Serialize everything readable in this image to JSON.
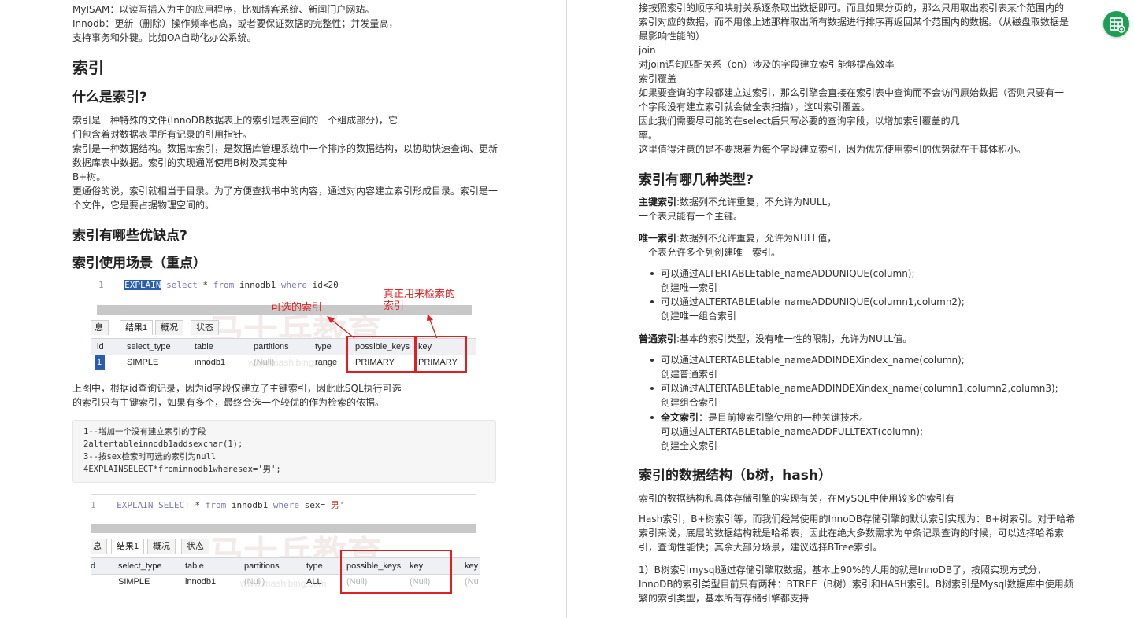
{
  "left": {
    "intro_lines": [
      "MyISAM：以读写插入为主的应用程序，比如博客系统、新闻门户网站。",
      "Innodb：更新（删除）操作频率也高，或者要保证数据的完整性；并发量高，",
      "支持事务和外键。比如OA自动化办公系统。"
    ],
    "h_index": "索引",
    "h_what": "什么是索引?",
    "what_lines": [
      "索引是一种特殊的文件(InnoDB数据表上的索引是表空间的一个组成部分)，它",
      "们包含着对数据表里所有记录的引用指针。",
      "索引是一种数据结构。数据库索引，是数据库管理系统中一个排序的数据结构，以协助快速查询、更新",
      "数据库表中数据。索引的实现通常使用B树及其变种",
      "B+树。",
      "更通俗的说，索引就相当于目录。为了方便查找书中的内容，通过对内容建立索引形成目录。索引是一",
      "个文件，它是要占据物理空间的。"
    ],
    "h_proscons": "索引有哪些优缺点?",
    "h_scenario": "索引使用场景（重点）",
    "fig1": {
      "line_no": "1",
      "kw_explain": "EXPLAIN",
      "rest": [
        " ",
        "select",
        " * ",
        "from",
        " innodb1 ",
        "where",
        " id<20"
      ],
      "note_possible": "可选的索引",
      "note_key_1": "真正用来检索的",
      "note_key_2": "索引",
      "tabs": [
        "息",
        "结果1",
        "概况",
        "状态"
      ],
      "headers": [
        "id",
        "select_type",
        "table",
        "partitions",
        "type",
        "possible_keys",
        "key"
      ],
      "row": [
        "1",
        "SIMPLE",
        "innodb1",
        "(Null)",
        "range",
        "PRIMARY",
        "PRIMARY"
      ],
      "wm_url": "www.mashibing.com"
    },
    "after_fig1_lines": [
      "上图中，根据id查询记录，因为id字段仅建立了主键索引，因此此SQL执行可选",
      "的索引只有主键索引，如果有多个，最终会选一个较优的作为检索的依据。"
    ],
    "code_lines": [
      "1--增加一个没有建立索引的字段",
      "2altertableinnodb1addsexchar(1);",
      "3--按sex检索时可选的索引为null",
      "4EXPLAINSELECT*frominnodb1wheresex='男';"
    ],
    "fig2": {
      "line_no": "1",
      "tokens": [
        "EXPLAIN SELECT",
        " * ",
        "from",
        " innodb1 ",
        "where",
        " sex=",
        "'男'"
      ],
      "tabs": [
        "息",
        "结果1",
        "概况",
        "状态"
      ],
      "headers": [
        "d",
        "select_type",
        "table",
        "partitions",
        "type",
        "possible_keys",
        "key",
        "key"
      ],
      "row": [
        "",
        "SIMPLE",
        "innodb1",
        "(Null)",
        "ALL",
        "(Null)",
        "(Null)",
        "(Nu"
      ],
      "wm_url": "www.mashibing.com"
    }
  },
  "right": {
    "top_lines": [
      "接按照索引的顺序和映射关系逐条取出数据即可。而且如果分页的，那么只用取出索引表某个范围内的",
      "索引对应的数据，而不用像上述那样取出所有数据进行排序再返回某个范围内的数据。（从磁盘取数据是",
      "最影响性能的）",
      "join",
      "对join语句匹配关系（on）涉及的字段建立索引能够提高效率",
      "索引覆盖",
      "如果要查询的字段都建立过索引，那么引擎会直接在索引表中查询而不会访问原始数据（否则只要有一",
      "个字段没有建立索引就会做全表扫描），这叫索引覆盖。",
      "因此我们需要尽可能的在select后只写必要的查询字段，以增加索引覆盖的几",
      "率。",
      "这里值得注意的是不要想着为每个字段建立索引，因为优先使用索引的优势就在于其体积小。"
    ],
    "h_types": "索引有哪几种类型?",
    "primary_label": "主键索引",
    "primary_text": ":数据列不允许重复，不允许为NULL，",
    "primary_text2": "一个表只能有一个主键。",
    "unique_label": "唯一索引",
    "unique_text": ":数据列不允许重复，允许为NULL值，",
    "unique_text2": "一个表允许多个列创建唯一索引。",
    "unique_bullets": [
      [
        "可以通过ALTERTABLEtable_nameADDUNIQUE(column);",
        "创建唯一索引"
      ],
      [
        "可以通过ALTERTABLEtable_nameADDUNIQUE(column1,column2);",
        "创建唯一组合索引"
      ]
    ],
    "normal_label": "普通索引",
    "normal_text": ":基本的索引类型，没有唯一性的限制，允许为NULL值。",
    "normal_bullets": [
      [
        "可以通过ALTERTABLEtable_nameADDINDEXindex_name(column);",
        "创建普通索引"
      ],
      [
        "可以通过ALTERTABLEtable_nameADDINDEXindex_name(column1,column2,column3);",
        "创建组合索引"
      ]
    ],
    "fulltext_label": "全文索引",
    "fulltext_text": "：是目前搜索引擎使用的一种关键技术。",
    "fulltext_text2": "可以通过ALTERTABLEtable_nameADDFULLTEXT(column);",
    "fulltext_text3": "创建全文索引",
    "h_struct": "索引的数据结构（b树，hash）",
    "struct_p1": "索引的数据结构和具体存储引擎的实现有关，在MySQL中使用较多的索引有",
    "struct_p2_lines": [
      "Hash索引，B+树索引等，而我们经常使用的InnoDB存储引擎的默认索引实现为：B+树索引。对于哈希",
      "索引来说，底层的数据结构就是哈希表，因此在绝大多数需求为单条记录查询的时候，可以选择哈希索",
      "引，查询性能快；其余大部分场景，建议选择BTree索引。"
    ],
    "struct_p3_lines": [
      "1）B树索引mysql通过存储引擎取数据，基本上90%的人用的就是InnoDB了，按照实现方式分，",
      "InnoDB的索引类型目前只有两种：BTREE（B树）索引和HASH索引。B树索引是Mysql数据库中使用频",
      "繁的索引类型，基本所有存储引擎都支持"
    ]
  },
  "colors": {
    "fab": "#1f9d55",
    "highlight": "#2a5db0",
    "annotation": "#e02020"
  },
  "fab_icon": "table-grid-icon"
}
